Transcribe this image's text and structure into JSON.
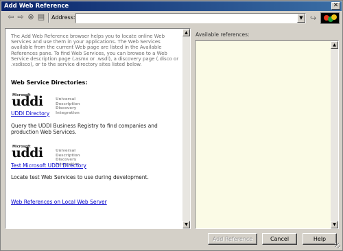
{
  "window": {
    "title": "Add Web Reference",
    "close_glyph": "✕"
  },
  "toolbar": {
    "icons": [
      "back-icon",
      "forward-icon",
      "stop-icon",
      "home-icon",
      "go-icon"
    ],
    "address_label": "Address:",
    "address_value": "",
    "dropdown_glyph": "▼"
  },
  "browser": {
    "intro": "The Add Web Reference browser helps you to locate online Web Services and use them in your applications. The Web Services available from the current Web page are listed in the Available References pane. To find Web Services, you can browse to a Web Service description page (.asmx or .wsdl), a discovery page (.disco or .vsdisco), or to the service directory sites listed below.",
    "heading": "Web Service Directories:",
    "logo": {
      "ms": "Microsoft",
      "word": "uddi",
      "desc1": "Universal Description",
      "desc2": "Discovery Integration"
    },
    "directories": [
      {
        "link": "UDDI Directory",
        "description": "Query the UDDI Business Registry to find companies and production Web Services."
      },
      {
        "link": "Test Microsoft UDDI Directory",
        "description": "Locate test Web Services to use during development."
      }
    ],
    "local_link": "Web References on Local Web Server"
  },
  "references": {
    "label": "Available references:"
  },
  "buttons": {
    "add_reference": "Add Reference",
    "cancel": "Cancel",
    "help": "Help"
  },
  "colors": {
    "title_start": "#0a246a",
    "title_end": "#3a6ea5",
    "link": "#0000cc",
    "ref_bg": "#fbfbe6",
    "face": "#d4d0c8"
  }
}
